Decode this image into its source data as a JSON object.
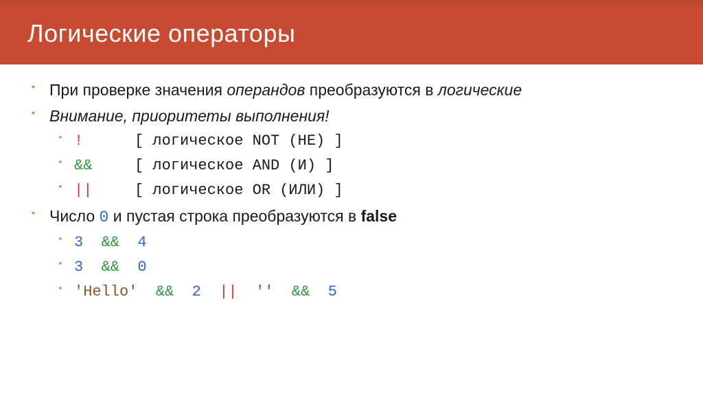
{
  "header": {
    "title": "Логические операторы"
  },
  "b1_pre": "При проверке значения ",
  "b1_i1": "операндов",
  "b1_mid": " преобразуются в ",
  "b1_i2": "логические",
  "b2": "Внимание, приоритеты выполнения!",
  "op_not_sym": "!",
  "op_not_desc": "[ логическое NOT (НЕ) ]",
  "op_and_sym": "&&",
  "op_and_desc": "[ логическое AND (И) ]",
  "op_or_sym": "||",
  "op_or_desc": "[ логическое OR (ИЛИ) ]",
  "b3_pre": "Число ",
  "b3_zero": "0",
  "b3_mid": " и пустая строка преобразуются в ",
  "b3_false": "false",
  "ex1_a": "3",
  "ex1_op1": "&&",
  "ex1_b": "4",
  "ex2_a": "3",
  "ex2_op1": "&&",
  "ex2_b": "0",
  "ex3_a": "'Hello'",
  "ex3_op1": "&&",
  "ex3_b": "2",
  "ex3_op2": "||",
  "ex3_c": "''",
  "ex3_op3": "&&",
  "ex3_d": "5"
}
